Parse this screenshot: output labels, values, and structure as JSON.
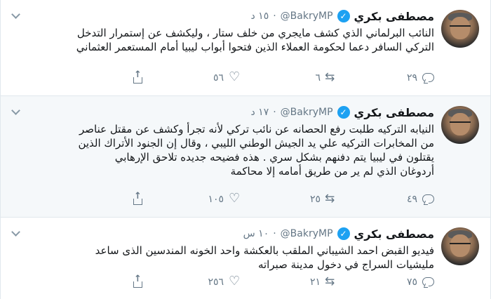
{
  "tweets": [
    {
      "author": "مصطفى بكري",
      "handle": "@BakryMP",
      "separator": "·",
      "time": "١٥ د",
      "text": "النائب البرلماني الذي كشف مايجري من خلف ستار ، وليكشف عن إستمرار التدخل\nالتركي السافر دعما لحكومة العملاء الذين فتحوا أبواب ليبيا أمام المستعمر العثماني",
      "replies": "٢٩",
      "retweets": "٦",
      "likes": "٥٦",
      "icons": {
        "reply": "reply-icon",
        "retweet": "retweet-icon",
        "like": "like-icon",
        "share": "share-icon"
      }
    },
    {
      "author": "مصطفى بكري",
      "handle": "@BakryMP",
      "separator": "·",
      "time": "١٧ د",
      "text": "النيابه التركيه طلبت رفع الحصانه عن نائب تركي لأنه تجرأ وكشف عن مقتل عناصر\nمن المخابرات التركيه علي يد الجيش الوطني الليبي ، وقال إن الجنود الأتراك الذين\nيقتلون في ليبيا يتم دفنهم بشكل سري . هذه فضيحه جديده تلاحق الإرهابي\nأردوغان الذي لم ير من طريق أمامه إلا محاكمة",
      "replies": "٤٩",
      "retweets": "٢٥",
      "likes": "١٠٥",
      "icons": {
        "reply": "reply-icon",
        "retweet": "retweet-icon",
        "like": "like-icon",
        "share": "share-icon"
      }
    },
    {
      "author": "مصطفى بكري",
      "handle": "@BakryMP",
      "separator": "·",
      "time": "١٠ س",
      "text": "فيديو القبض احمد الشيباني الملقب بالعكشة واحد الخونه المندسين الذى ساعد\nمليشيات السراج في دخول مدينة صبراته",
      "replies": "٧٥",
      "retweets": "٢١",
      "likes": "٢٥٦",
      "icons": {
        "reply": "reply-icon",
        "retweet": "retweet-icon",
        "like": "like-icon",
        "share": "share-icon"
      }
    }
  ],
  "icons": {
    "verified": "verified-badge-icon",
    "more": "chevron-down-icon",
    "avatar": "avatar"
  },
  "colors": {
    "accent": "#1da1f2",
    "text": "#14171a",
    "muted": "#657786",
    "border": "#e1e8ed",
    "hover_bg": "#f5f8fa"
  }
}
